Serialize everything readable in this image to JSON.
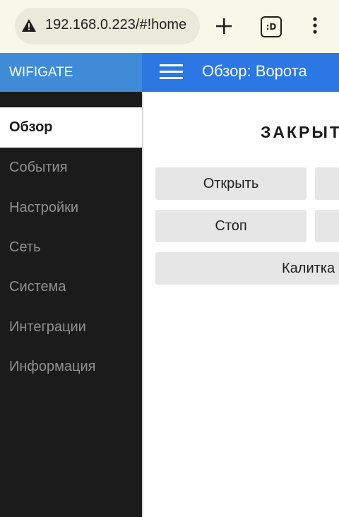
{
  "browser": {
    "url": "192.168.0.223/#!home",
    "tabs_count": ":D"
  },
  "sidebar": {
    "brand": "WIFIGATE",
    "items": [
      {
        "label": "Обзор",
        "active": true
      },
      {
        "label": "События"
      },
      {
        "label": "Настройки"
      },
      {
        "label": "Сеть"
      },
      {
        "label": "Система"
      },
      {
        "label": "Интеграции"
      },
      {
        "label": "Информация"
      }
    ]
  },
  "header": {
    "title": "Обзор: Ворота"
  },
  "main": {
    "status": "ЗАКРЫТ",
    "buttons": {
      "open": "Открыть",
      "stop": "Стоп",
      "wicket": "Калитка"
    }
  },
  "colors": {
    "brand_bg": "#3f8bd8",
    "header_bg": "#2b78e4",
    "sidebar_bg": "#1b1b1b",
    "button_bg": "#e6e6e6"
  }
}
